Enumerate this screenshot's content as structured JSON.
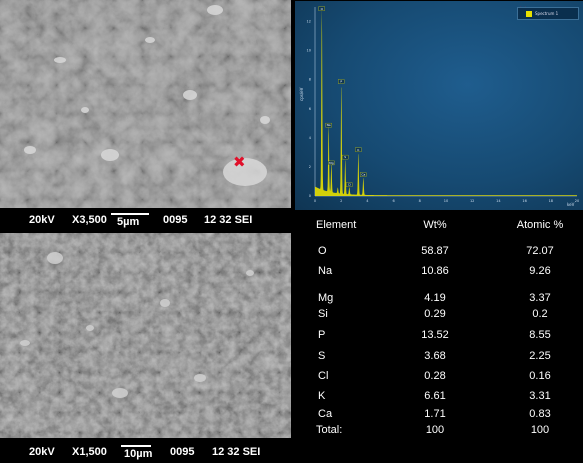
{
  "micrograph_top": {
    "voltage": "20kV",
    "magnification": "X3,500",
    "scale": "5µm",
    "number": "0095",
    "mode": "12 32 SEI"
  },
  "micrograph_bottom": {
    "voltage": "20kV",
    "magnification": "X1,500",
    "scale": "10µm",
    "number": "0095",
    "mode": "12 32 SEI"
  },
  "spectrum": {
    "legend": "Spectrum 1",
    "y_axis_label": "cps/eV",
    "x_axis_label": "keV",
    "y_ticks": [
      "12",
      "10",
      "8",
      "6",
      "4",
      "2",
      "0"
    ],
    "x_ticks": [
      "0",
      "2",
      "4",
      "6",
      "8",
      "10",
      "12",
      "14",
      "16",
      "18",
      "20"
    ],
    "peak_labels": [
      "O",
      "Na",
      "Mg",
      "P",
      "S",
      "Cl",
      "K",
      "Ca"
    ],
    "series_color": "#e8e000",
    "background_color": "#164a72"
  },
  "composition": {
    "headers": [
      "Element",
      "Wt%",
      "Atomic %"
    ],
    "rows": [
      {
        "element": "O",
        "wt": "58.87",
        "atomic": "72.07"
      },
      {
        "element": "Na",
        "wt": "10.86",
        "atomic": "9.26"
      },
      {
        "element": "Mg",
        "wt": "4.19",
        "atomic": "3.37"
      },
      {
        "element": "Si",
        "wt": "0.29",
        "atomic": "0.2"
      },
      {
        "element": "P",
        "wt": "13.52",
        "atomic": "8.55"
      },
      {
        "element": "S",
        "wt": "3.68",
        "atomic": "2.25"
      },
      {
        "element": "Cl",
        "wt": "0.28",
        "atomic": "0.16"
      },
      {
        "element": "K",
        "wt": "6.61",
        "atomic": "3.31"
      },
      {
        "element": "Ca",
        "wt": "1.71",
        "atomic": "0.83"
      },
      {
        "element": "Total:",
        "wt": "100",
        "atomic": "100"
      }
    ]
  }
}
